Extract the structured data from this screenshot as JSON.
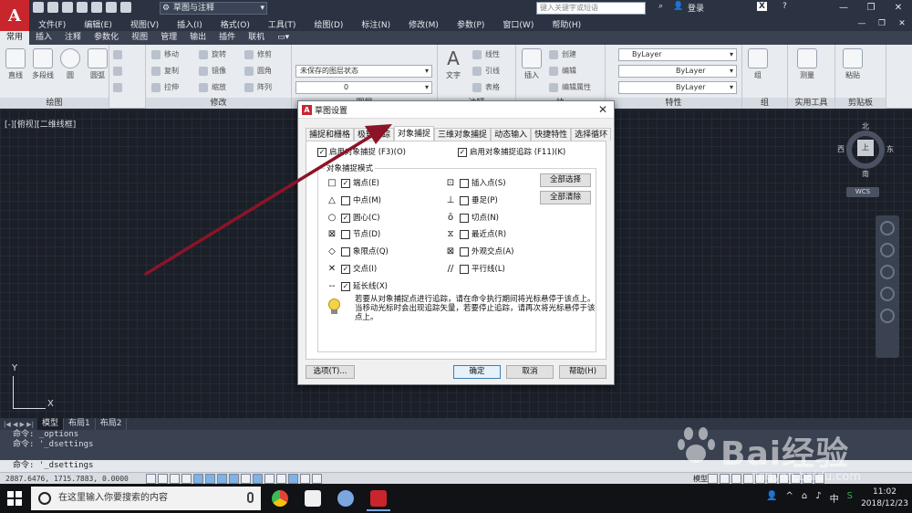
{
  "app": {
    "workspace": "草图与注释",
    "title": "",
    "search_placeholder": "键入关键字或短语",
    "login": "登录",
    "help": "?"
  },
  "menubar": {
    "items": [
      "文件(F)",
      "编辑(E)",
      "视图(V)",
      "插入(I)",
      "格式(O)",
      "工具(T)",
      "绘图(D)",
      "标注(N)",
      "修改(M)",
      "参数(P)",
      "窗口(W)",
      "帮助(H)"
    ]
  },
  "ribbon_tabs": {
    "items": [
      "常用",
      "插入",
      "注释",
      "参数化",
      "视图",
      "管理",
      "输出",
      "插件",
      "联机"
    ],
    "active": "常用"
  },
  "ribbon": {
    "draw": {
      "title": "绘图",
      "tools": [
        "直线",
        "多段线",
        "圆",
        "圆弧"
      ]
    },
    "modify": {
      "title": "修改",
      "tools": [
        "移动",
        "旋转",
        "修剪",
        "复制",
        "镜像",
        "圆角",
        "拉伸",
        "缩放",
        "阵列"
      ]
    },
    "layer": {
      "title": "图层",
      "state": "未保存的图层状态",
      "current": "0"
    },
    "annotation": {
      "title": "注释",
      "text": "文字",
      "linear": "线性",
      "leader": "引线",
      "table": "表格"
    },
    "block": {
      "title": "块",
      "insert": "插入",
      "create": "创建",
      "edit": "编辑",
      "edit_attr": "编辑属性"
    },
    "properties": {
      "title": "特性",
      "color": "ByLayer",
      "linetype": "ByLayer",
      "lineweight": "ByLayer"
    },
    "group": {
      "title": "组",
      "label": "组"
    },
    "utilities": {
      "title": "实用工具",
      "measure": "测量"
    },
    "clipboard": {
      "title": "剪贴板",
      "paste": "粘贴"
    }
  },
  "viewport": {
    "label": "[-][俯视][二维线框]",
    "ucs_x": "X",
    "ucs_y": "Y",
    "compass": {
      "north": "北",
      "south": "南",
      "east": "东",
      "west": "西",
      "top": "上"
    },
    "wcs": "WCS"
  },
  "layout_tabs": {
    "items": [
      "模型",
      "布局1",
      "布局2"
    ],
    "active": "模型"
  },
  "command": {
    "history": [
      "命令: _options",
      "命令: '_dsettings"
    ],
    "current": "命令: '_dsettings"
  },
  "statusbar": {
    "coords": "2887.6476, 1715.7883, 0.0000",
    "model": "模型"
  },
  "taskbar": {
    "search_text": "在这里输入你要搜索的内容",
    "time": "11:02",
    "date": "2018/12/23"
  },
  "dialog": {
    "title": "草图设置",
    "tabs": [
      "捕捉和栅格",
      "极轴追踪",
      "对象捕捉",
      "三维对象捕捉",
      "动态输入",
      "快捷特性",
      "选择循环"
    ],
    "active_tab": "对象捕捉",
    "enable_osnap": {
      "label": "启用对象捕捉 (F3)(O)",
      "checked": true
    },
    "enable_tracking": {
      "label": "启用对象捕捉追踪 (F11)(K)",
      "checked": true
    },
    "group_title": "对象捕捉模式",
    "left_modes": [
      {
        "symbol": "□",
        "label": "端点(E)",
        "checked": true
      },
      {
        "symbol": "△",
        "label": "中点(M)",
        "checked": false
      },
      {
        "symbol": "○",
        "label": "圆心(C)",
        "checked": true
      },
      {
        "symbol": "⊠",
        "label": "节点(D)",
        "checked": false
      },
      {
        "symbol": "◇",
        "label": "象限点(Q)",
        "checked": false
      },
      {
        "symbol": "✕",
        "label": "交点(I)",
        "checked": true
      },
      {
        "symbol": "--",
        "label": "延长线(X)",
        "checked": true
      }
    ],
    "right_modes": [
      {
        "symbol": "⊡",
        "label": "插入点(S)",
        "checked": false
      },
      {
        "symbol": "⊥",
        "label": "垂足(P)",
        "checked": false
      },
      {
        "symbol": "ō",
        "label": "切点(N)",
        "checked": false
      },
      {
        "symbol": "⧖",
        "label": "最近点(R)",
        "checked": false
      },
      {
        "symbol": "⊠",
        "label": "外观交点(A)",
        "checked": false
      },
      {
        "symbol": "//",
        "label": "平行线(L)",
        "checked": false
      }
    ],
    "select_all": "全部选择",
    "clear_all": "全部清除",
    "tip": "若要从对象捕捉点进行追踪，请在命令执行期间将光标悬停于该点上。当移动光标时会出现追踪矢量，若要停止追踪，请再次将光标悬停于该点上。",
    "buttons": {
      "options": "选项(T)...",
      "ok": "确定",
      "cancel": "取消",
      "help": "帮助(H)"
    }
  },
  "watermark": {
    "brand": "Bai经验",
    "url": "jingyan.baidu.com"
  },
  "colors": {
    "accent": "#c9252c",
    "annotation_arrow": "#8b1428",
    "ribbon_bg": "#e8ebef",
    "canvas_bg": "#1b1f27"
  }
}
